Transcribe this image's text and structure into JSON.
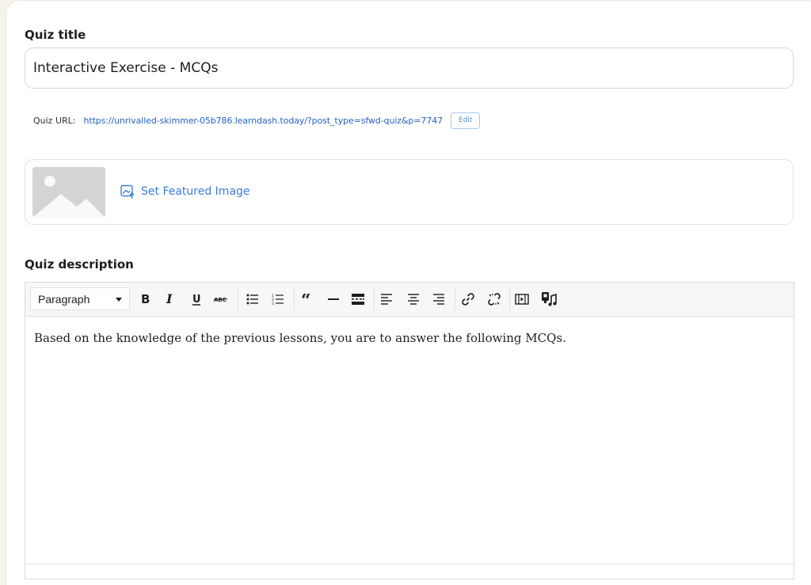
{
  "quiz_title": {
    "label": "Quiz title",
    "value": "Interactive Exercise - MCQs"
  },
  "quiz_url": {
    "label": "Quiz URL:",
    "url": "https://unrivalled-skimmer-05b786.learndash.today/?post_type=sfwd-quiz&p=7747",
    "edit_label": "Edit"
  },
  "featured_image": {
    "link_label": "Set Featured Image",
    "icon": "image-upload-icon"
  },
  "quiz_description": {
    "label": "Quiz description",
    "format_select": "Paragraph",
    "toolbar_icons": [
      "bold-icon",
      "italic-icon",
      "underline-icon",
      "strikethrough-icon",
      "bullet-list-icon",
      "numbered-list-icon",
      "blockquote-icon",
      "horizontal-line-icon",
      "read-more-icon",
      "align-left-icon",
      "align-center-icon",
      "align-right-icon",
      "link-icon",
      "unlink-icon",
      "insert-media-icon",
      "audio-icon"
    ],
    "content": "Based on the knowledge of the previous lessons, you are to answer the following MCQs."
  },
  "colors": {
    "link": "#2563c7",
    "accent": "#3b7ddd",
    "page_background": "#f6f3ec"
  }
}
